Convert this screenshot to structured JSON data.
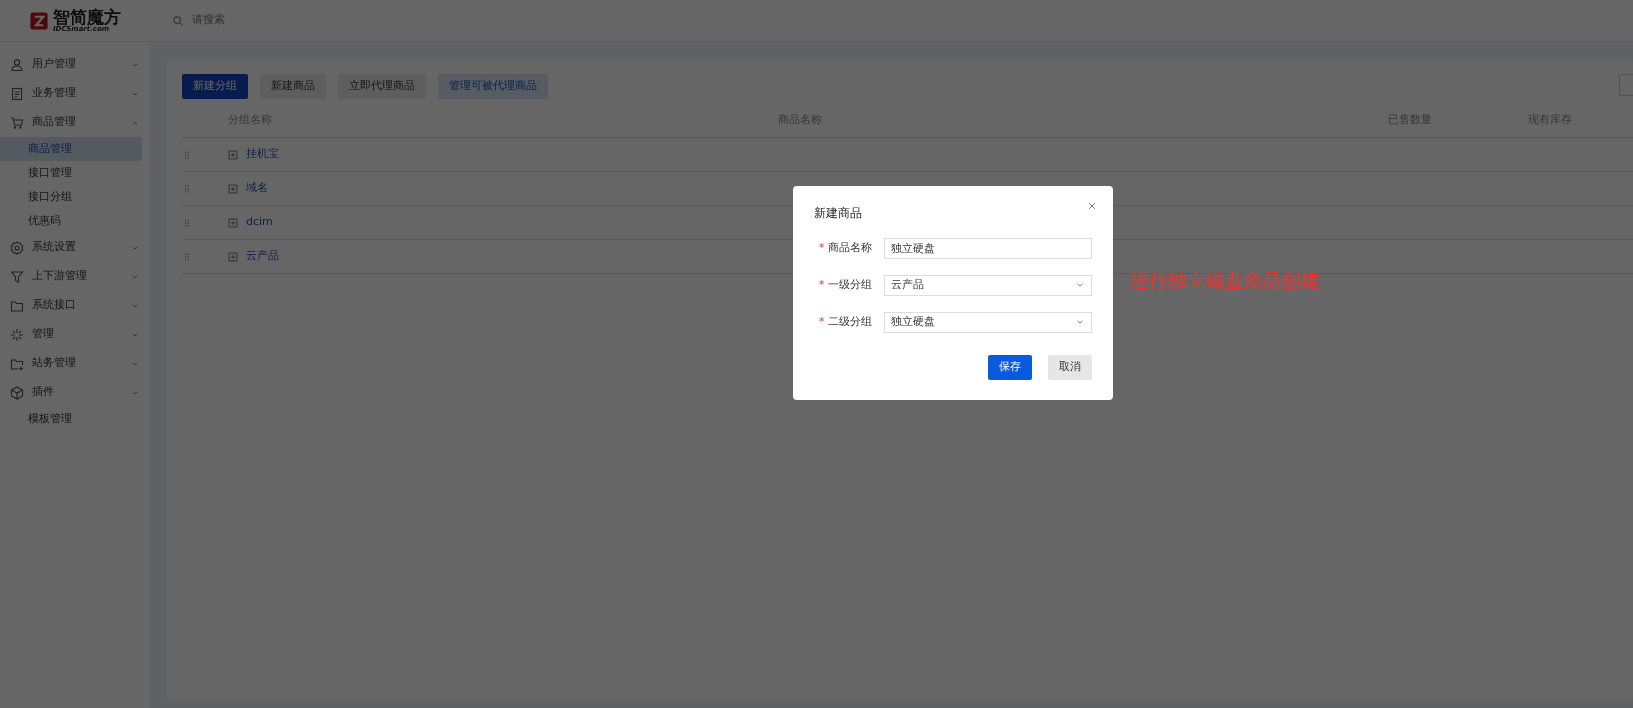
{
  "header": {
    "logo_text": "智简魔方",
    "logo_subtext": "IDCSmart.com",
    "search": {
      "placeholder": "请搜索"
    }
  },
  "sidebar": {
    "items": [
      {
        "label": "用户管理",
        "expanded": false
      },
      {
        "label": "业务管理",
        "expanded": false
      },
      {
        "label": "商品管理",
        "expanded": true,
        "children": [
          {
            "label": "商品管理",
            "selected": true
          },
          {
            "label": "接口管理",
            "selected": false
          },
          {
            "label": "接口分组",
            "selected": false
          },
          {
            "label": "优惠码",
            "selected": false
          }
        ]
      },
      {
        "label": "系统设置",
        "expanded": false
      },
      {
        "label": "上下游管理",
        "expanded": false
      },
      {
        "label": "系统接口",
        "expanded": false
      },
      {
        "label": "管理",
        "expanded": false
      },
      {
        "label": "站务管理",
        "expanded": false
      },
      {
        "label": "插件",
        "expanded": false,
        "children": [
          {
            "label": "模板管理",
            "selected": false
          }
        ]
      }
    ]
  },
  "toolbar": {
    "buttons": [
      {
        "label": "新建分组",
        "kind": "primary"
      },
      {
        "label": "新建商品",
        "kind": "default"
      },
      {
        "label": "立即代理商品",
        "kind": "default"
      },
      {
        "label": "管理可被代理商品",
        "kind": "light"
      }
    ]
  },
  "table": {
    "columns": [
      "分组名称",
      "商品名称",
      "已售数量",
      "现有库存"
    ],
    "rows": [
      {
        "name": "挂机宝"
      },
      {
        "name": "域名"
      },
      {
        "name": "dcim"
      },
      {
        "name": "云产品"
      }
    ]
  },
  "dialog": {
    "title": "新建商品",
    "fields": [
      {
        "label": "商品名称",
        "kind": "input",
        "required_mark": "*",
        "value": "独立硬盘"
      },
      {
        "label": "一级分组",
        "kind": "select",
        "required_mark": "*",
        "value": "云产品"
      },
      {
        "label": "二级分组",
        "kind": "select",
        "required_mark": "*",
        "value": "独立硬盘"
      }
    ],
    "buttons": [
      {
        "label": "保存",
        "kind": "primary"
      },
      {
        "label": "取消",
        "kind": "default"
      }
    ]
  },
  "annotation": "进行独立磁盘商品创建"
}
